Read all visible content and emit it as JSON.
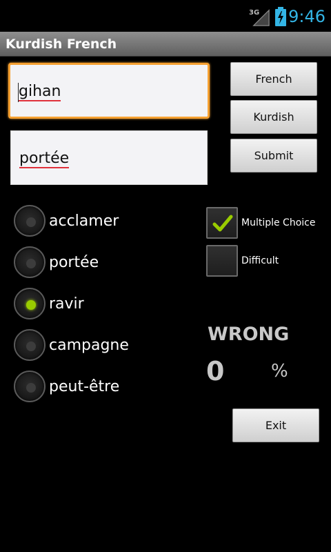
{
  "status_bar": {
    "network": "3G",
    "time": "9:46"
  },
  "app": {
    "title": "Kurdish French"
  },
  "inputs": {
    "kurdish_word": "gihan",
    "french_word": "portée"
  },
  "buttons": {
    "french": "French",
    "kurdish": "Kurdish",
    "submit": "Submit",
    "exit": "Exit"
  },
  "choices": [
    {
      "label": "acclamer",
      "checked": false
    },
    {
      "label": "portée",
      "checked": false
    },
    {
      "label": "ravir",
      "checked": true
    },
    {
      "label": "campagne",
      "checked": false
    },
    {
      "label": "peut-être",
      "checked": false
    }
  ],
  "options": {
    "multiple_choice": {
      "label": "Multiple Choice",
      "checked": true
    },
    "difficult": {
      "label": "Difficult",
      "checked": false
    }
  },
  "result": {
    "status": "WRONG",
    "score": "0",
    "unit": "%"
  },
  "colors": {
    "accent": "#33b5e5",
    "focus": "#f5a031",
    "radio_checked": "#99cc00",
    "check_mark": "#99cc00"
  }
}
